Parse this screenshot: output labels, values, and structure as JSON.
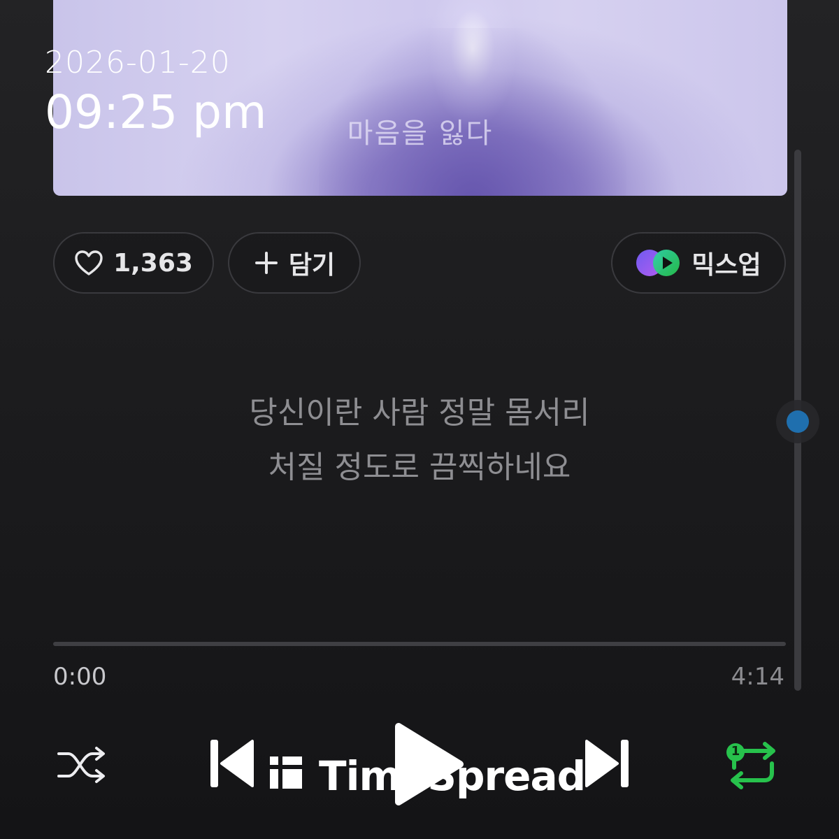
{
  "overlay": {
    "date": "2026-01-20",
    "time": "09:25 pm"
  },
  "album": {
    "caption": "마음을 잃다"
  },
  "actions": {
    "like_count": "1,363",
    "add_label": "담기",
    "mixup_label": "믹스업"
  },
  "lyrics": {
    "line1": "당신이란 사람 정말 몸서리",
    "line2": "처질 정도로 끔찍하네요"
  },
  "playback": {
    "elapsed": "0:00",
    "duration": "4:14",
    "progress": 0,
    "repeat_badge": "1"
  },
  "watermark": {
    "text": "TimeSpread"
  },
  "colors": {
    "accent_green": "#27c24c",
    "scroll_dot": "#1f6fae",
    "album_purple": "#7565b8"
  },
  "icons": {
    "like": "heart-icon",
    "add": "plus-icon",
    "mixup": "mixup-logo-icon",
    "shuffle": "shuffle-icon",
    "prev": "skip-previous-icon",
    "play": "play-icon",
    "next": "skip-next-icon",
    "repeat": "repeat-one-icon"
  }
}
